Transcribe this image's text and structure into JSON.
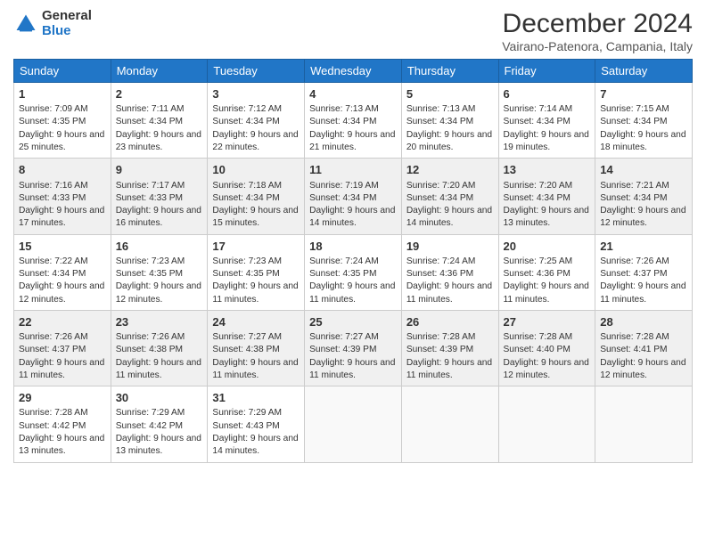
{
  "logo": {
    "general": "General",
    "blue": "Blue"
  },
  "title": "December 2024",
  "location": "Vairano-Patenora, Campania, Italy",
  "days_of_week": [
    "Sunday",
    "Monday",
    "Tuesday",
    "Wednesday",
    "Thursday",
    "Friday",
    "Saturday"
  ],
  "weeks": [
    [
      {
        "day": "1",
        "sunrise": "7:09 AM",
        "sunset": "4:35 PM",
        "daylight": "9 hours and 25 minutes."
      },
      {
        "day": "2",
        "sunrise": "7:11 AM",
        "sunset": "4:34 PM",
        "daylight": "9 hours and 23 minutes."
      },
      {
        "day": "3",
        "sunrise": "7:12 AM",
        "sunset": "4:34 PM",
        "daylight": "9 hours and 22 minutes."
      },
      {
        "day": "4",
        "sunrise": "7:13 AM",
        "sunset": "4:34 PM",
        "daylight": "9 hours and 21 minutes."
      },
      {
        "day": "5",
        "sunrise": "7:13 AM",
        "sunset": "4:34 PM",
        "daylight": "9 hours and 20 minutes."
      },
      {
        "day": "6",
        "sunrise": "7:14 AM",
        "sunset": "4:34 PM",
        "daylight": "9 hours and 19 minutes."
      },
      {
        "day": "7",
        "sunrise": "7:15 AM",
        "sunset": "4:34 PM",
        "daylight": "9 hours and 18 minutes."
      }
    ],
    [
      {
        "day": "8",
        "sunrise": "7:16 AM",
        "sunset": "4:33 PM",
        "daylight": "9 hours and 17 minutes."
      },
      {
        "day": "9",
        "sunrise": "7:17 AM",
        "sunset": "4:33 PM",
        "daylight": "9 hours and 16 minutes."
      },
      {
        "day": "10",
        "sunrise": "7:18 AM",
        "sunset": "4:34 PM",
        "daylight": "9 hours and 15 minutes."
      },
      {
        "day": "11",
        "sunrise": "7:19 AM",
        "sunset": "4:34 PM",
        "daylight": "9 hours and 14 minutes."
      },
      {
        "day": "12",
        "sunrise": "7:20 AM",
        "sunset": "4:34 PM",
        "daylight": "9 hours and 14 minutes."
      },
      {
        "day": "13",
        "sunrise": "7:20 AM",
        "sunset": "4:34 PM",
        "daylight": "9 hours and 13 minutes."
      },
      {
        "day": "14",
        "sunrise": "7:21 AM",
        "sunset": "4:34 PM",
        "daylight": "9 hours and 12 minutes."
      }
    ],
    [
      {
        "day": "15",
        "sunrise": "7:22 AM",
        "sunset": "4:34 PM",
        "daylight": "9 hours and 12 minutes."
      },
      {
        "day": "16",
        "sunrise": "7:23 AM",
        "sunset": "4:35 PM",
        "daylight": "9 hours and 12 minutes."
      },
      {
        "day": "17",
        "sunrise": "7:23 AM",
        "sunset": "4:35 PM",
        "daylight": "9 hours and 11 minutes."
      },
      {
        "day": "18",
        "sunrise": "7:24 AM",
        "sunset": "4:35 PM",
        "daylight": "9 hours and 11 minutes."
      },
      {
        "day": "19",
        "sunrise": "7:24 AM",
        "sunset": "4:36 PM",
        "daylight": "9 hours and 11 minutes."
      },
      {
        "day": "20",
        "sunrise": "7:25 AM",
        "sunset": "4:36 PM",
        "daylight": "9 hours and 11 minutes."
      },
      {
        "day": "21",
        "sunrise": "7:26 AM",
        "sunset": "4:37 PM",
        "daylight": "9 hours and 11 minutes."
      }
    ],
    [
      {
        "day": "22",
        "sunrise": "7:26 AM",
        "sunset": "4:37 PM",
        "daylight": "9 hours and 11 minutes."
      },
      {
        "day": "23",
        "sunrise": "7:26 AM",
        "sunset": "4:38 PM",
        "daylight": "9 hours and 11 minutes."
      },
      {
        "day": "24",
        "sunrise": "7:27 AM",
        "sunset": "4:38 PM",
        "daylight": "9 hours and 11 minutes."
      },
      {
        "day": "25",
        "sunrise": "7:27 AM",
        "sunset": "4:39 PM",
        "daylight": "9 hours and 11 minutes."
      },
      {
        "day": "26",
        "sunrise": "7:28 AM",
        "sunset": "4:39 PM",
        "daylight": "9 hours and 11 minutes."
      },
      {
        "day": "27",
        "sunrise": "7:28 AM",
        "sunset": "4:40 PM",
        "daylight": "9 hours and 12 minutes."
      },
      {
        "day": "28",
        "sunrise": "7:28 AM",
        "sunset": "4:41 PM",
        "daylight": "9 hours and 12 minutes."
      }
    ],
    [
      {
        "day": "29",
        "sunrise": "7:28 AM",
        "sunset": "4:42 PM",
        "daylight": "9 hours and 13 minutes."
      },
      {
        "day": "30",
        "sunrise": "7:29 AM",
        "sunset": "4:42 PM",
        "daylight": "9 hours and 13 minutes."
      },
      {
        "day": "31",
        "sunrise": "7:29 AM",
        "sunset": "4:43 PM",
        "daylight": "9 hours and 14 minutes."
      },
      null,
      null,
      null,
      null
    ]
  ],
  "labels": {
    "sunrise": "Sunrise:",
    "sunset": "Sunset:",
    "daylight": "Daylight:"
  }
}
